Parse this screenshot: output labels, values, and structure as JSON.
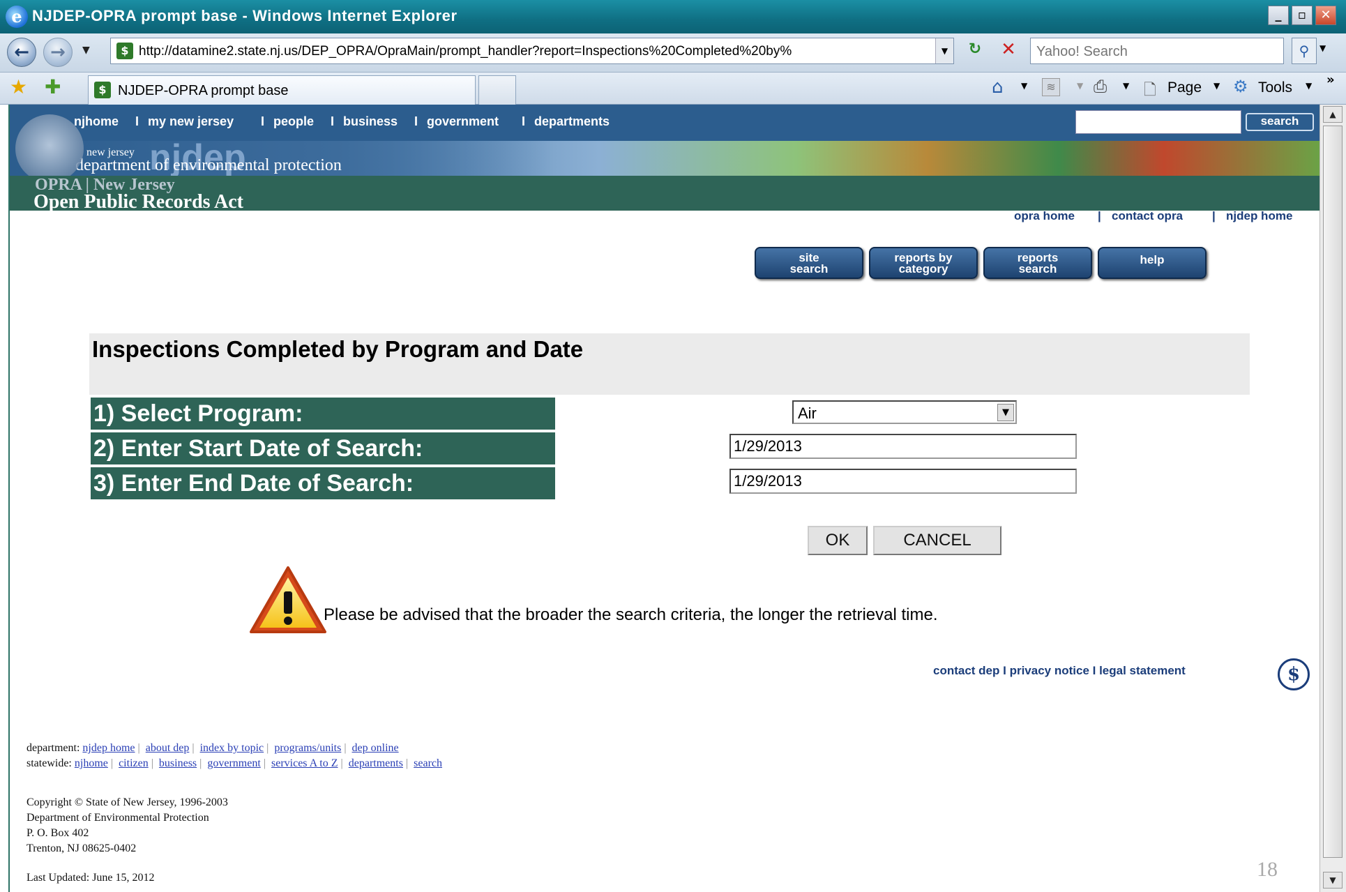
{
  "window": {
    "title": "NJDEP-OPRA prompt base - Windows Internet Explorer",
    "minimize": "_",
    "restore": "▫",
    "close": "✕"
  },
  "browser": {
    "url": "http://datamine2.state.nj.us/DEP_OPRA/OpraMain/prompt_handler?report=Inspections%20Completed%20by%",
    "search_placeholder": "Yahoo! Search",
    "tab_title": "NJDEP-OPRA prompt base",
    "page_menu": "Page",
    "tools_menu": "Tools",
    "overflow": "»"
  },
  "site_nav": {
    "links": [
      "njhome",
      "my new jersey",
      "people",
      "business",
      "government",
      "departments"
    ],
    "separator": "I",
    "search_button": "search"
  },
  "banner": {
    "brand_small": "new jersey",
    "brand_big": "njdep",
    "agency": "department of environmental protection",
    "opra_small": "OPRA | New Jersey",
    "opra_big": "Open Public Records Act"
  },
  "opra_links": {
    "home": "opra home",
    "contact": "contact opra",
    "njdep": "njdep home",
    "sep": "|"
  },
  "action_buttons": {
    "site_search_1": "site",
    "site_search_2": "search",
    "reports_by_category_1": "reports by",
    "reports_by_category_2": "category",
    "reports_search_1": "reports",
    "reports_search_2": "search",
    "help": "help"
  },
  "form": {
    "title": "Inspections Completed by Program and Date",
    "q1": "1) Select Program:",
    "q2": "2) Enter Start Date of Search:",
    "q3": "3) Enter End Date of Search:",
    "program_value": "Air",
    "start_date": "1/29/2013",
    "end_date": "1/29/2013",
    "ok": "OK",
    "cancel": "CANCEL",
    "warning": "Please be advised that the broader the search criteria, the longer the retrieval time."
  },
  "footer": {
    "legal_links": "contact dep I privacy notice I legal statement",
    "department_label": "department:",
    "department_links": [
      "njdep home",
      "about dep",
      "index by topic",
      "programs/units",
      "dep online"
    ],
    "statewide_label": "statewide:",
    "statewide_links": [
      "njhome",
      "citizen",
      "business",
      "government",
      "services A to Z",
      "departments",
      "search"
    ],
    "copyright": "Copyright © State of New Jersey, 1996-2003",
    "address_1": "Department of Environmental Protection",
    "address_2": "P. O. Box 402",
    "address_3": "Trenton, NJ 08625-0402",
    "last_updated": "Last Updated: June 15, 2012"
  },
  "slide_number": "18",
  "colors": {
    "nav_blue": "#2c5d8e",
    "opra_green": "#2e6457",
    "link_blue": "#1b3d7a"
  }
}
